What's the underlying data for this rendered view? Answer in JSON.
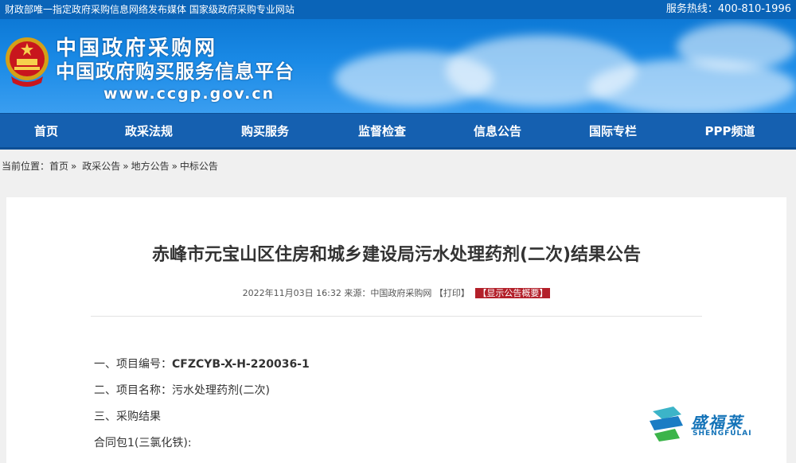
{
  "topbar": {
    "left": "财政部唯一指定政府采购信息网络发布媒体 国家级政府采购专业网站",
    "hotline": "服务热线：400-810-1996"
  },
  "banner": {
    "title1": "中国政府采购网",
    "title2": "中国政府购买服务信息平台",
    "url": "www.ccgp.gov.cn"
  },
  "nav": [
    "首页",
    "政采法规",
    "购买服务",
    "监督检查",
    "信息公告",
    "国际专栏",
    "PPP频道"
  ],
  "breadcrumb": {
    "prefix": "当前位置：",
    "items": [
      "首页",
      "政采公告",
      "地方公告",
      "中标公告"
    ],
    "sep": "»"
  },
  "article": {
    "title": "赤峰市元宝山区住房和城乡建设局污水处理药剂(二次)结果公告",
    "datetime": "2022年11月03日 16:32",
    "source": "来源：中国政府采购网",
    "print": "【打印】",
    "summary": "【显示公告概要】",
    "lines": [
      {
        "label": "一、项目编号：",
        "value": "CFZCYB-X-H-220036-1"
      },
      {
        "label": "二、项目名称：",
        "value": "污水处理药剂(二次)"
      },
      {
        "label": "三、采购结果",
        "value": ""
      },
      {
        "label": "合同包1(三氯化铁):",
        "value": ""
      }
    ]
  },
  "watermark": {
    "name": "盛福莱",
    "sub": "SHENGFULAI"
  }
}
